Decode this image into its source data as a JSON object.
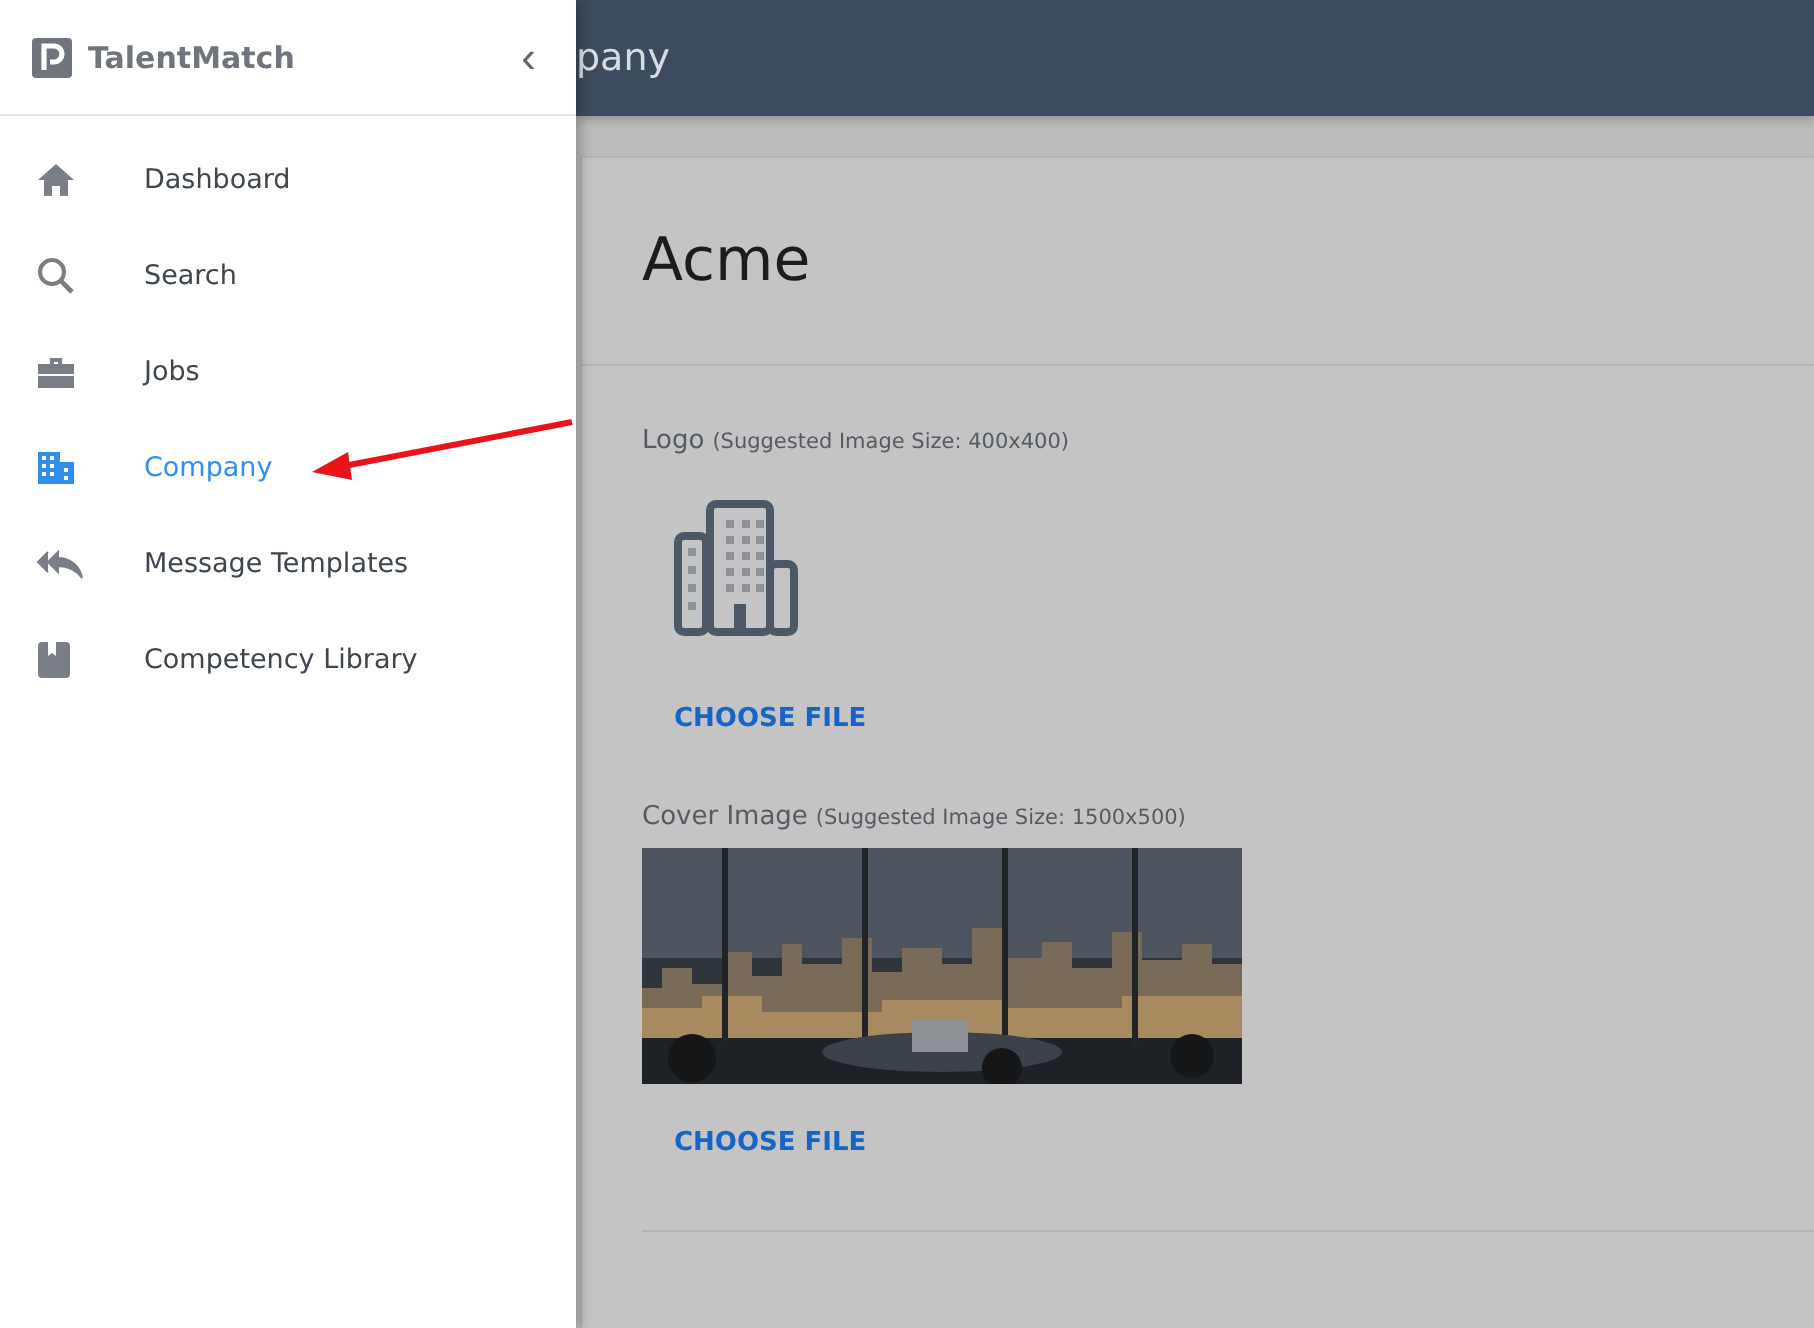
{
  "sidebar": {
    "brand": "TalentMatch",
    "collapse": "‹",
    "items": [
      {
        "label": "Dashboard",
        "selected": false
      },
      {
        "label": "Search",
        "selected": false
      },
      {
        "label": "Jobs",
        "selected": false
      },
      {
        "label": "Company",
        "selected": true
      },
      {
        "label": "Message Templates",
        "selected": false
      },
      {
        "label": "Competency Library",
        "selected": false
      }
    ]
  },
  "header": {
    "title": "pany"
  },
  "company": {
    "name": "Acme",
    "sections": [
      {
        "kind": "logo",
        "label": "Logo",
        "hint": "(Suggested Image Size: 400x400)",
        "button": "CHOOSE FILE"
      },
      {
        "kind": "picture",
        "label": "Cover Image",
        "hint": "(Suggested Image Size: 1500x500)",
        "button": "CHOOSE FILE"
      }
    ]
  }
}
